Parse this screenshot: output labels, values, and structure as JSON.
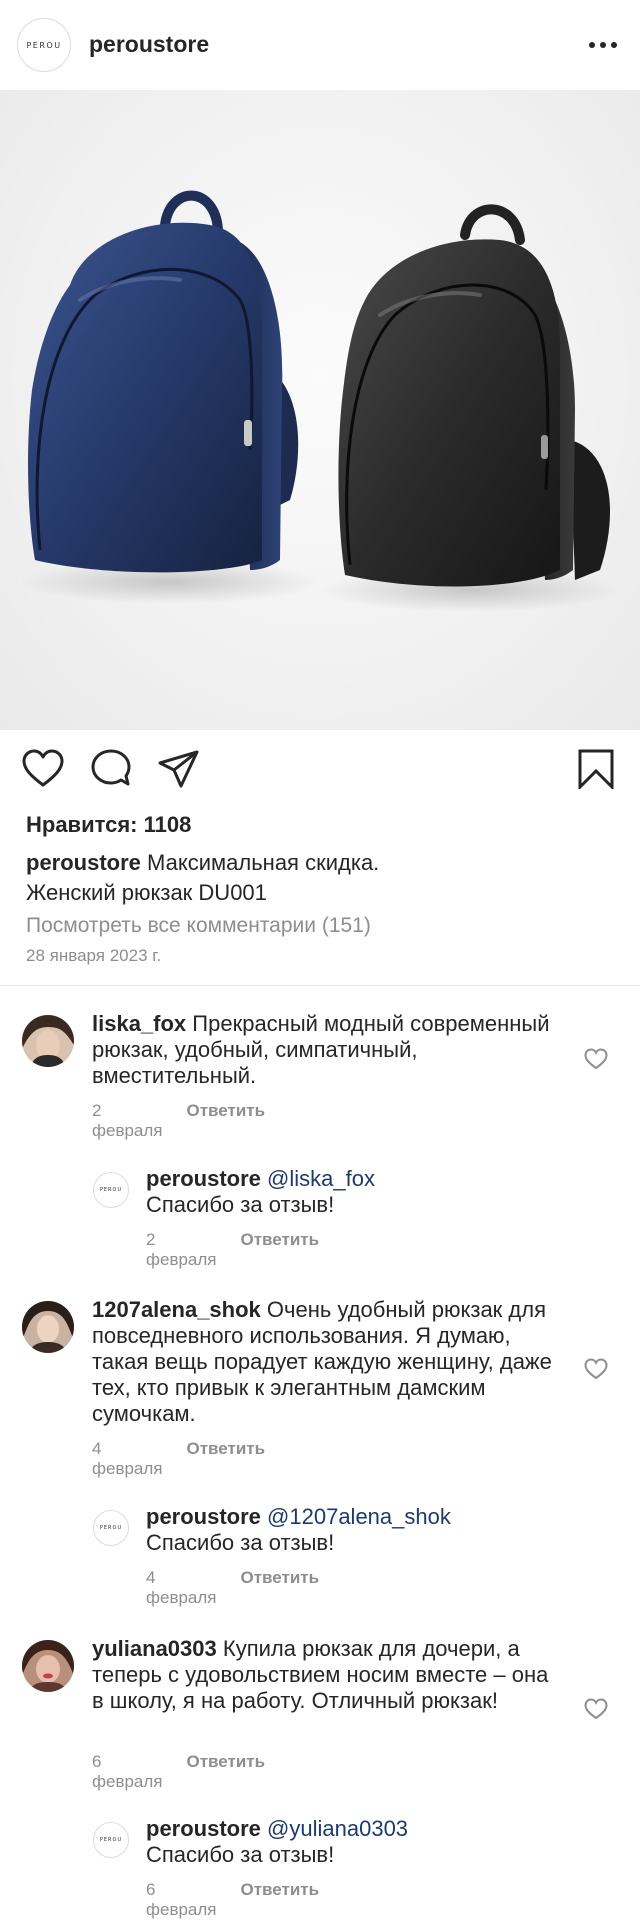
{
  "header": {
    "avatar_logo": "PEROU",
    "username": "peroustore",
    "more_icon": "more-horizontal-icon"
  },
  "post": {
    "image_alt": "Two leather backpacks: navy blue and black",
    "likes_label": "Нравится: 1108",
    "caption_user": "peroustore",
    "caption_text": "Максимальная скидка.",
    "caption_line2": "Женский рюкзак DU001",
    "view_all": "Посмотреть все комментарии (151)",
    "date": "28 января 2023 г."
  },
  "actions": {
    "like_icon": "heart-icon",
    "comment_icon": "comment-icon",
    "share_icon": "send-icon",
    "save_icon": "bookmark-icon"
  },
  "comments": [
    {
      "user": "liska_fox",
      "text": "Прекрасный модный современный рюкзак, удобный, симпатичный, вместительный.",
      "date": "2 февраля",
      "reply_label": "Ответить",
      "reply": {
        "user": "peroustore",
        "mention": "@liska_fox",
        "text": "Спасибо за отзыв!",
        "date": "2 февраля",
        "reply_label": "Ответить"
      }
    },
    {
      "user": "1207alena_shok",
      "text": "Очень удобный рюкзак для повседневного использования. Я думаю, такая вещь порадует каждую женщину, даже тех, кто привык к элегантным дамским сумочкам.",
      "date": "4 февраля",
      "reply_label": "Ответить",
      "reply": {
        "user": "peroustore",
        "mention": "@1207alena_shok",
        "text": "Спасибо за отзыв!",
        "date": "4 февраля",
        "reply_label": "Ответить"
      }
    },
    {
      "user": "yuliana0303",
      "text": "Купила рюкзак для дочери, а теперь с удовольствием носим вместе – она в школу, я на работу. Отличный рюкзак!",
      "date": "6 февраля",
      "reply_label": "Ответить",
      "reply": {
        "user": "peroustore",
        "mention": "@yuliana0303",
        "text": "Спасибо за отзыв!",
        "date": "6 февраля",
        "reply_label": "Ответить"
      }
    }
  ],
  "colors": {
    "text": "#262626",
    "muted": "#8e8e8e",
    "mention": "#1d3a6e",
    "backpack_blue": "#23355f",
    "backpack_black": "#262626"
  }
}
